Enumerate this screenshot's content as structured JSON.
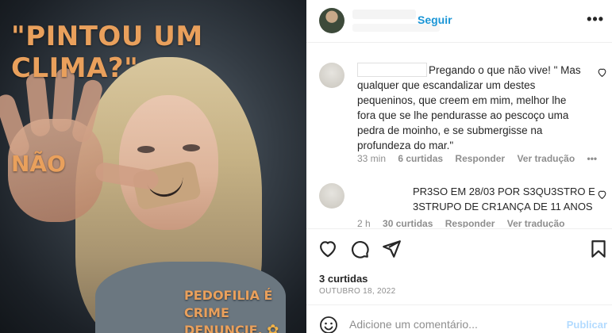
{
  "post_image": {
    "headline": "\"PINTOU UM CLIMA?\"",
    "hand_text": "NÃO",
    "footer_line1": "PEDOFILIA É CRIME",
    "footer_line2": "DENUNCIE.",
    "footer_icon": "flower-icon",
    "accent_color": "#e9a05c"
  },
  "header": {
    "follow_label": "Seguir",
    "more_icon": "more-options-icon",
    "follow_color": "#1a95d6"
  },
  "comments": [
    {
      "text": "Pregando o que não vive! \" Mas qualquer que escandalizar um destes pequeninos, que creem em mim, melhor lhe fora que se lhe pendurasse ao pescoço uma pedra de moinho, e se submergisse na profundeza do mar.\"",
      "time": "33 min",
      "likes": "6 curtidas",
      "reply": "Responder",
      "translate": "Ver tradução",
      "more": "•••"
    },
    {
      "text": "PR3SO EM 28/03 POR S3QU3STRO E 3STRUPO DE CR1ANÇA DE 11 ANOS",
      "time": "2 h",
      "likes": "30 curtidas",
      "reply": "Responder",
      "translate": "Ver tradução"
    }
  ],
  "actions": {
    "icons": [
      "heart-icon",
      "comment-icon",
      "share-icon",
      "bookmark-icon"
    ],
    "likes": "3 curtidas",
    "date": "OUTUBRO 18, 2022"
  },
  "add_comment": {
    "placeholder": "Adicione um comentário...",
    "publish_label": "Publicar",
    "publish_color": "#b3dbff"
  }
}
